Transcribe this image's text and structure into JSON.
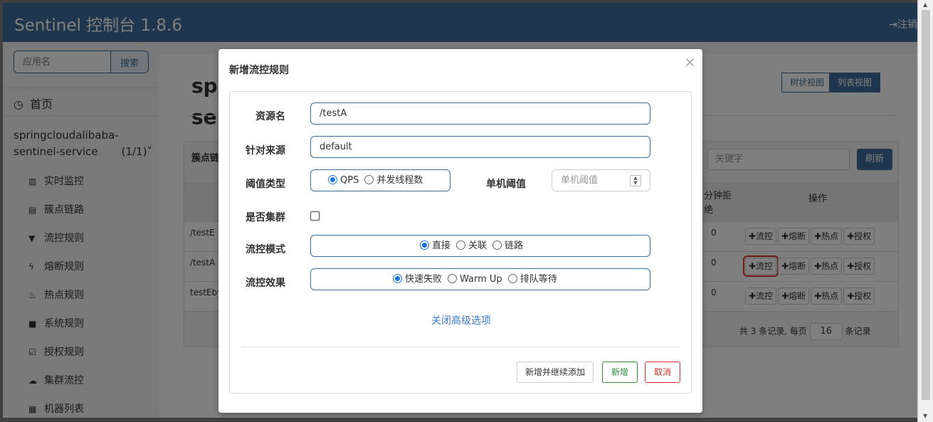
{
  "app_title": "Sentinel 控制台 1.8.6",
  "logout_label": "注销",
  "sidebar": {
    "search_placeholder": "应用名",
    "search_button": "搜索",
    "home": "首页",
    "app_name": "springcloudalibaba-sentinel-service",
    "app_count": "(1/1)",
    "menu": [
      {
        "label": "实时监控",
        "icon": "bar-chart-icon"
      },
      {
        "label": "簇点链路",
        "icon": "list-icon"
      },
      {
        "label": "流控规则",
        "icon": "filter-icon"
      },
      {
        "label": "熔断规则",
        "icon": "bolt-icon"
      },
      {
        "label": "热点规则",
        "icon": "fire-icon"
      },
      {
        "label": "系统规则",
        "icon": "lock-icon"
      },
      {
        "label": "授权规则",
        "icon": "check-square-icon"
      },
      {
        "label": "集群流控",
        "icon": "cloud-icon"
      },
      {
        "label": "机器列表",
        "icon": "grid-icon"
      }
    ]
  },
  "main": {
    "title_line1": "sp",
    "title_line2": "se",
    "view_tree": "树状视图",
    "view_list": "列表视图",
    "panel_title": "簇点链路",
    "keyword_placeholder": "关键字",
    "refresh": "刷新",
    "col_reject_a": "分钟拒",
    "col_reject_b": "绝",
    "col_ops": "操作",
    "rows": [
      {
        "resource": "/testE",
        "reject": "0"
      },
      {
        "resource": "/testA",
        "reject": "0"
      },
      {
        "resource": "testEbyA",
        "reject": "0"
      }
    ],
    "op_labels": [
      "✚流控",
      "✚熔断",
      "✚热点",
      "✚授权"
    ],
    "pager_prefix": "共 3 条记录, 每页",
    "pager_size": "16",
    "pager_suffix": "条记录"
  },
  "modal": {
    "title": "新增流控规则",
    "close": "×",
    "resource_label": "资源名",
    "resource_value": "/testA",
    "origin_label": "针对来源",
    "origin_value": "default",
    "grade_label": "阈值类型",
    "grade_qps": "QPS",
    "grade_thread": "并发线程数",
    "threshold_label": "单机阈值",
    "threshold_placeholder": "单机阈值",
    "cluster_label": "是否集群",
    "mode_label": "流控模式",
    "mode_direct": "直接",
    "mode_relate": "关联",
    "mode_chain": "链路",
    "effect_label": "流控效果",
    "effect_fast": "快速失败",
    "effect_warmup": "Warm Up",
    "effect_queue": "排队等待",
    "advanced_toggle": "关闭高级选项",
    "btn_add_continue": "新增并继续添加",
    "btn_add": "新增",
    "btn_cancel": "取消"
  },
  "colors": {
    "brand": "#3c6e9c",
    "add_green": "#2e8b3e",
    "cancel_red": "#c9302c",
    "highlight": "#e0322b"
  }
}
